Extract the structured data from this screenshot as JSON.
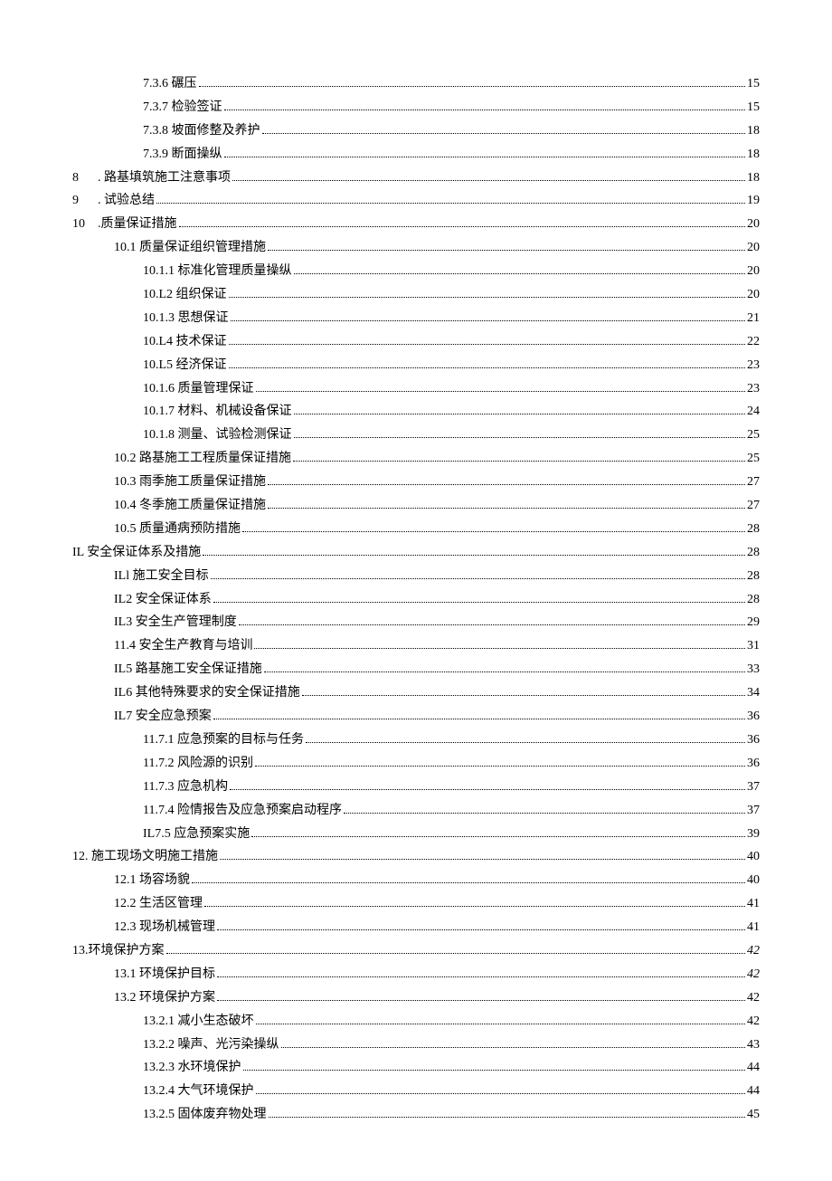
{
  "toc": [
    {
      "indent": 2,
      "label": "7.3.6 碾压",
      "page": "15"
    },
    {
      "indent": 2,
      "label": "7.3.7 检验签证",
      "page": "15"
    },
    {
      "indent": 2,
      "label": "7.3.8 坡面修整及养护",
      "page": "18"
    },
    {
      "indent": 2,
      "label": "7.3.9 断面操纵",
      "page": "18"
    },
    {
      "indent": 0,
      "prefix": "8",
      "label": ". 路基填筑施工注意事项",
      "page": "18"
    },
    {
      "indent": 0,
      "prefix": "9",
      "label": ". 试验总结",
      "page": "19"
    },
    {
      "indent": 0,
      "prefix": "10",
      "label": ".质量保证措施",
      "page": "20"
    },
    {
      "indent": 1,
      "label": "10.1 质量保证组织管理措施",
      "page": "20"
    },
    {
      "indent": 2,
      "label": "10.1.1 标准化管理质量操纵",
      "page": "20"
    },
    {
      "indent": 2,
      "label": "10.L2 组织保证",
      "page": "20"
    },
    {
      "indent": 2,
      "label": "10.1.3 思想保证",
      "page": "21"
    },
    {
      "indent": 2,
      "label": "10.L4 技术保证",
      "page": "22"
    },
    {
      "indent": 2,
      "label": "10.L5 经济保证",
      "page": "23"
    },
    {
      "indent": 2,
      "label": "10.1.6 质量管理保证",
      "page": "23"
    },
    {
      "indent": 2,
      "label": "10.1.7 材料、机械设备保证",
      "page": "24"
    },
    {
      "indent": 2,
      "label": "10.1.8 测量、试验检测保证",
      "page": "25"
    },
    {
      "indent": 1,
      "label": "10.2 路基施工工程质量保证措施",
      "page": "25"
    },
    {
      "indent": 1,
      "label": "10.3 雨季施工质量保证措施",
      "page": "27"
    },
    {
      "indent": 1,
      "label": "10.4 冬季施工质量保证措施",
      "page": "27"
    },
    {
      "indent": 1,
      "label": "10.5 质量通病预防措施",
      "page": "28"
    },
    {
      "indent": 0,
      "label": "IL 安全保证体系及措施",
      "page": "28"
    },
    {
      "indent": 1,
      "label": "ILl 施工安全目标",
      "page": "28"
    },
    {
      "indent": 1,
      "label": "IL2 安全保证体系",
      "page": "28"
    },
    {
      "indent": 1,
      "label": "IL3 安全生产管理制度",
      "page": "29"
    },
    {
      "indent": 1,
      "label": "11.4 安全生产教育与培训",
      "page": "31"
    },
    {
      "indent": 1,
      "label": "IL5 路基施工安全保证措施",
      "page": "33"
    },
    {
      "indent": 1,
      "label": "IL6 其他特殊要求的安全保证措施",
      "page": "34"
    },
    {
      "indent": 1,
      "label": "IL7 安全应急预案",
      "page": "36"
    },
    {
      "indent": 2,
      "label": "11.7.1 应急预案的目标与任务",
      "page": "36"
    },
    {
      "indent": 2,
      "label": "11.7.2 风险源的识别",
      "page": "36"
    },
    {
      "indent": 2,
      "label": "11.7.3 应急机构",
      "page": "37"
    },
    {
      "indent": 2,
      "label": "11.7.4 险情报告及应急预案启动程序",
      "page": "37"
    },
    {
      "indent": 2,
      "label": "IL7.5 应急预案实施",
      "page": "39"
    },
    {
      "indent": 0,
      "label": "12. 施工现场文明施工措施",
      "page": "40"
    },
    {
      "indent": 1,
      "label": "12.1 场容场貌",
      "page": "40"
    },
    {
      "indent": 1,
      "label": "12.2 生活区管理",
      "page": "41"
    },
    {
      "indent": 1,
      "label": "12.3 现场机械管理",
      "page": "41"
    },
    {
      "indent": 0,
      "label": "13.环境保护方案",
      "page": "42",
      "italic": true
    },
    {
      "indent": 1,
      "label": "13.1 环境保护目标",
      "page": "42",
      "italic": true
    },
    {
      "indent": 1,
      "label": "13.2 环境保护方案",
      "page": "42"
    },
    {
      "indent": 2,
      "label": "13.2.1 减小生态破坏",
      "page": "42"
    },
    {
      "indent": 2,
      "label": "13.2.2 噪声、光污染操纵",
      "page": "43"
    },
    {
      "indent": 2,
      "label": "13.2.3 水环境保护",
      "page": "44"
    },
    {
      "indent": 2,
      "label": "13.2.4 大气环境保护",
      "page": "44"
    },
    {
      "indent": 2,
      "label": "13.2.5 固体废弃物处理",
      "page": "45"
    }
  ]
}
